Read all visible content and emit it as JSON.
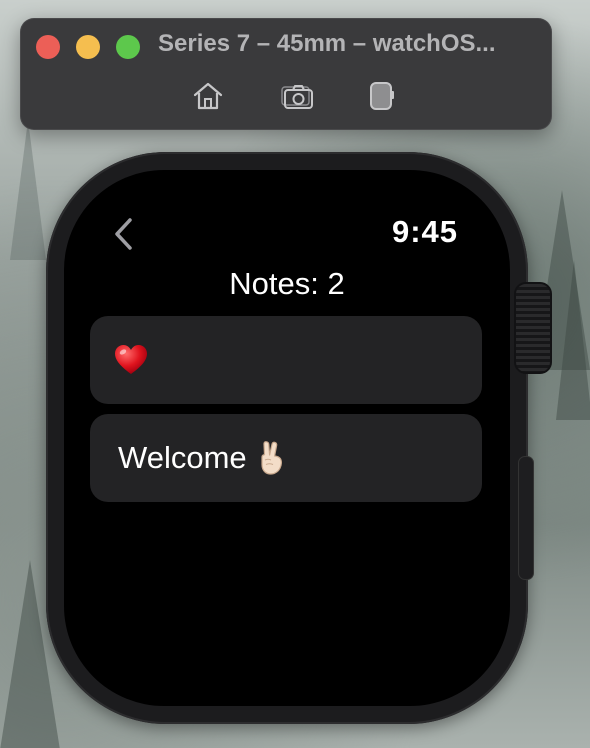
{
  "window": {
    "title": "Series 7 – 45mm – watchOS...",
    "toolbar": [
      {
        "icon": "home-icon"
      },
      {
        "icon": "screenshot-icon"
      },
      {
        "icon": "rotate-device-icon"
      }
    ]
  },
  "watch": {
    "status": {
      "time": "9:45",
      "back_icon": "chevron-left-icon"
    },
    "header": {
      "notes_count": "Notes: 2"
    },
    "notes": [
      {
        "text": "",
        "emoji": "red-heart"
      },
      {
        "text": "Welcome",
        "emoji": "victory-hand"
      }
    ]
  },
  "colors": {
    "close": "#ec5f57",
    "minimize": "#f5be4f",
    "maximize": "#5dc84c",
    "card_background": "#232325",
    "screen_background": "#000000"
  }
}
